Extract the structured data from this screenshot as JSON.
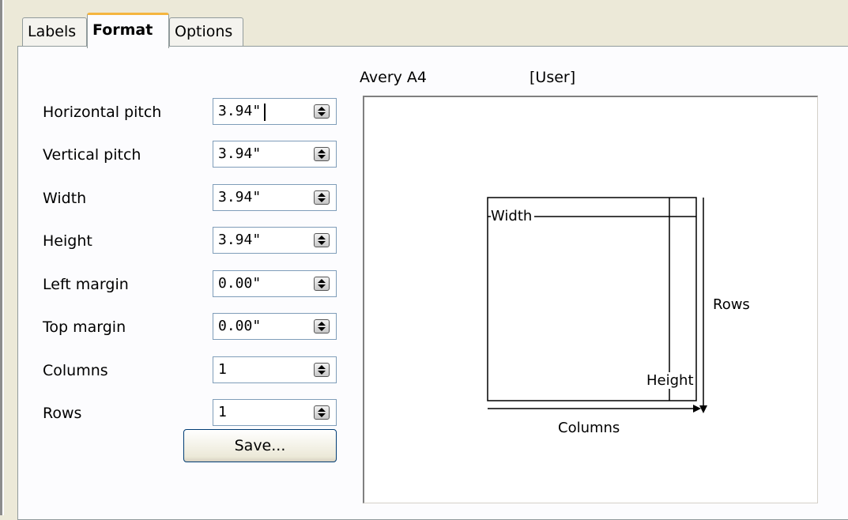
{
  "tabs": [
    {
      "label": "Labels",
      "active": false
    },
    {
      "label": "Format",
      "active": true
    },
    {
      "label": "Options",
      "active": false
    }
  ],
  "fields": [
    {
      "label": "Horizontal pitch",
      "value": "3.94\""
    },
    {
      "label": "Vertical pitch",
      "value": "3.94\""
    },
    {
      "label": "Width",
      "value": "3.94\""
    },
    {
      "label": "Height",
      "value": "3.94\""
    },
    {
      "label": "Left margin",
      "value": "0.00\""
    },
    {
      "label": "Top margin",
      "value": "0.00\""
    },
    {
      "label": "Columns",
      "value": "1"
    },
    {
      "label": "Rows",
      "value": "1"
    }
  ],
  "save_button": "Save...",
  "preview": {
    "brand": "Avery A4",
    "type": "[User]",
    "width_label": "Width",
    "height_label": "Height",
    "rows_label": "Rows",
    "columns_label": "Columns"
  },
  "colors": {
    "active_tab_accent": "#f5b53f",
    "dialog_bg": "#ece9d8",
    "field_border": "#7f9db9"
  }
}
